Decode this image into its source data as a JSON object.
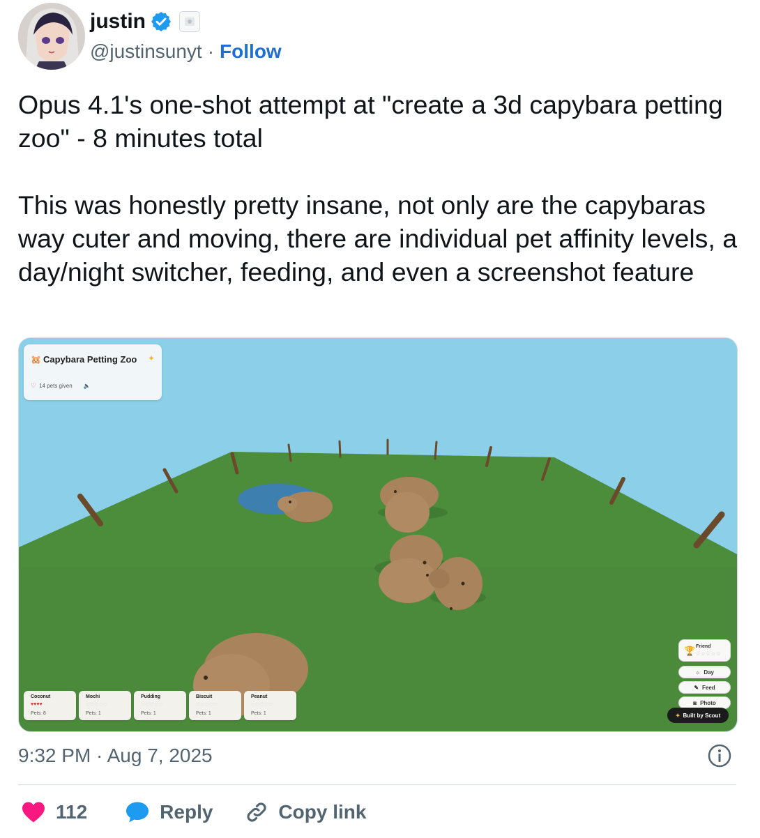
{
  "author": {
    "name": "justin",
    "handle": "@justinsunyt",
    "separator": "·",
    "follow_label": "Follow"
  },
  "tweet": {
    "paragraphs": [
      "Opus 4.1's one-shot attempt at \"create a 3d capybara petting zoo\" - 8 minutes total",
      "This was honestly pretty insane, not only are the capybaras way cuter and moving, there are individual pet affinity levels, a day/night switcher, feeding, and even a screenshot feature"
    ],
    "timestamp": "9:32 PM · Aug 7, 2025"
  },
  "media": {
    "app_title": "Capybara Petting Zoo",
    "pets_given": "14 pets given",
    "capybaras": [
      {
        "name": "Coconut",
        "hearts": "♥♥♥♥",
        "hearts_filled": 4,
        "pets": "Pets: 8"
      },
      {
        "name": "Mochi",
        "hearts": "♡♡♡♡♡",
        "hearts_filled": 0,
        "pets": "Pets: 1"
      },
      {
        "name": "Pudding",
        "hearts": "♡♡♡♡♡",
        "hearts_filled": 0,
        "pets": "Pets: 1"
      },
      {
        "name": "Biscuit",
        "hearts": "♡♡♡♡♡",
        "hearts_filled": 0,
        "pets": "Pets: 1"
      },
      {
        "name": "Peanut",
        "hearts": "♡♡♡♡♡",
        "hearts_filled": 0,
        "pets": "Pets: 1"
      }
    ],
    "affinity_label": "Friend",
    "affinity_stars": "☆☆☆☆☆",
    "day_label": "Day",
    "feed_label": "Feed",
    "photo_label": "Photo",
    "built_by": "Built by Scout",
    "colors": {
      "sky": "#8ccfe9",
      "grass": "#4a8a3a",
      "pond": "#3d7fae",
      "capybara": "#a9835c",
      "fence_post": "#6b4a2c"
    }
  },
  "actions": {
    "likes": "112",
    "reply_label": "Reply",
    "copy_link_label": "Copy link"
  },
  "colors": {
    "follow": "#1d6fd4",
    "verified": "#1d9bf0",
    "like_heart": "#f91880",
    "reply_bubble": "#1d9bf0",
    "secondary_text": "#536471"
  }
}
